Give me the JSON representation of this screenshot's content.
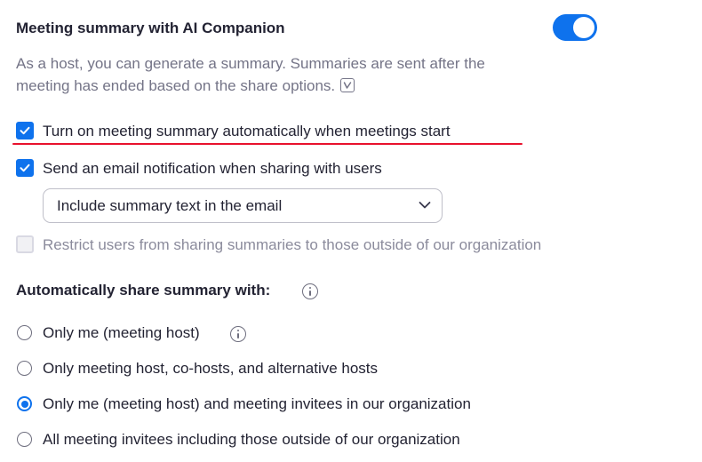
{
  "header": {
    "title": "Meeting summary with AI Companion",
    "toggle_on": true
  },
  "description": {
    "text": "As a host, you can generate a summary. Summaries are sent after the meeting has ended based on the share options.",
    "icon": "ai-companion-icon"
  },
  "options": {
    "auto_start": {
      "label": "Turn on meeting summary automatically when meetings start",
      "checked": true,
      "highlight_underline_color": "#e8112d"
    },
    "email_notification": {
      "label": "Send an email notification when sharing with users",
      "checked": true
    },
    "email_content_select": {
      "value": "Include summary text in the email"
    },
    "restrict_sharing": {
      "label": "Restrict users from sharing summaries to those outside of our organization",
      "checked": false,
      "disabled": true
    }
  },
  "share": {
    "title": "Automatically share summary with:",
    "options": [
      {
        "label": "Only me (meeting host)",
        "selected": false,
        "has_info": true
      },
      {
        "label": "Only meeting host, co-hosts, and alternative hosts",
        "selected": false
      },
      {
        "label": "Only me (meeting host) and meeting invitees in our organization",
        "selected": true
      },
      {
        "label": "All meeting invitees including those outside of our organization",
        "selected": false
      }
    ]
  },
  "colors": {
    "accent": "#0e72ed",
    "text": "#232333",
    "muted": "#747487"
  }
}
